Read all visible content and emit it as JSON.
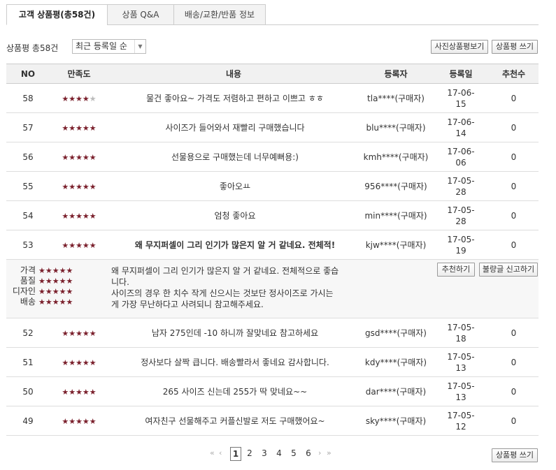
{
  "tabs": [
    {
      "label": "고객 상품평(총58건)",
      "active": true
    },
    {
      "label": "상품 Q&A",
      "active": false
    },
    {
      "label": "배송/교환/반품 정보",
      "active": false
    }
  ],
  "toolbar": {
    "count_prefix": "상품평 총",
    "count_value": "58",
    "count_suffix": "건",
    "sort_selected": "최근 등록일 순",
    "photo_reviews_button": "사진상품평보기",
    "write_review_button": "상품평 쓰기"
  },
  "columns": [
    "NO",
    "만족도",
    "내용",
    "등록자",
    "등록일",
    "추천수"
  ],
  "rows": [
    {
      "no": "58",
      "rating": 4,
      "content": "물건 좋아요~ 가격도 저렴하고 편하고 이쁘고 ㅎㅎ",
      "user": "tla****(구매자)",
      "date_line1": "17-06-",
      "date_line2": "15",
      "likes": "0"
    },
    {
      "no": "57",
      "rating": 5,
      "content": "사이즈가 들어와서 재빨리 구매했습니다",
      "user": "blu****(구매자)",
      "date_line1": "17-06-",
      "date_line2": "14",
      "likes": "0"
    },
    {
      "no": "56",
      "rating": 5,
      "content": "선물용으로 구매했는데 너무예뻐용:)",
      "user": "kmh****(구매자)",
      "date_line1": "17-06-",
      "date_line2": "06",
      "likes": "0"
    },
    {
      "no": "55",
      "rating": 5,
      "content": "좋아오ㅛ",
      "user": "956****(구매자)",
      "date_line1": "17-05-",
      "date_line2": "28",
      "likes": "0"
    },
    {
      "no": "54",
      "rating": 5,
      "content": "엄청 좋아요",
      "user": "min****(구매자)",
      "date_line1": "17-05-",
      "date_line2": "28",
      "likes": "0"
    },
    {
      "no": "53",
      "rating": 5,
      "content": "왜 무지퍼셀이 그리 인기가 많은지 알 거 같네요. 전체적!",
      "user": "kjw****(구매자)",
      "date_line1": "17-05-",
      "date_line2": "19",
      "likes": "0"
    },
    {
      "no": "52",
      "rating": 5,
      "content": "남자 275인데 -10 하니까 잘맞네요 참고하세요",
      "user": "gsd****(구매자)",
      "date_line1": "17-05-",
      "date_line2": "18",
      "likes": "0"
    },
    {
      "no": "51",
      "rating": 5,
      "content": "정사보다 살짝 큽니다. 배송빨라서 좋네요 감사합니다.",
      "user": "kdy****(구매자)",
      "date_line1": "17-05-",
      "date_line2": "13",
      "likes": "0"
    },
    {
      "no": "50",
      "rating": 5,
      "content": "265 사이즈 신는데 255가 딱 맞네요~~",
      "user": "dar****(구매자)",
      "date_line1": "17-05-",
      "date_line2": "13",
      "likes": "0"
    },
    {
      "no": "49",
      "rating": 5,
      "content": "여자친구 선물해주고 커플신발로 저도 구매했어요~",
      "user": "sky****(구매자)",
      "date_line1": "17-05-",
      "date_line2": "12",
      "likes": "0"
    }
  ],
  "detail": {
    "ratings": [
      {
        "label": "가격",
        "stars": 5
      },
      {
        "label": "품질",
        "stars": 5
      },
      {
        "label": "디자인",
        "stars": 5
      },
      {
        "label": "배송",
        "stars": 5
      }
    ],
    "text_line1": "왜 무지퍼셀이 그리 인기가 많은지 알 거 같네요. 전체적으로 좋습",
    "text_line2": "니다.",
    "text_line3": "사이즈의 경우 한 치수 작게 신으시는 것보단 정사이즈로 가시는",
    "text_line4": "게 가장 무난하다고 사려되니 참고해주세요.",
    "recommend_button": "추천하기",
    "report_button": "불량글 신고하기"
  },
  "pager": {
    "pages": [
      "1",
      "2",
      "3",
      "4",
      "5",
      "6"
    ],
    "current": "1",
    "first_label": "«",
    "prev_label": "‹",
    "next_label": "›",
    "last_label": "»"
  },
  "footer": {
    "write_review_button": "상품평 쓰기"
  },
  "colors": {
    "star": "#7a1f2b",
    "star_off": "#bbbbbb",
    "header_bg": "#f1f1f1",
    "detail_bg": "#f7f7f7"
  }
}
